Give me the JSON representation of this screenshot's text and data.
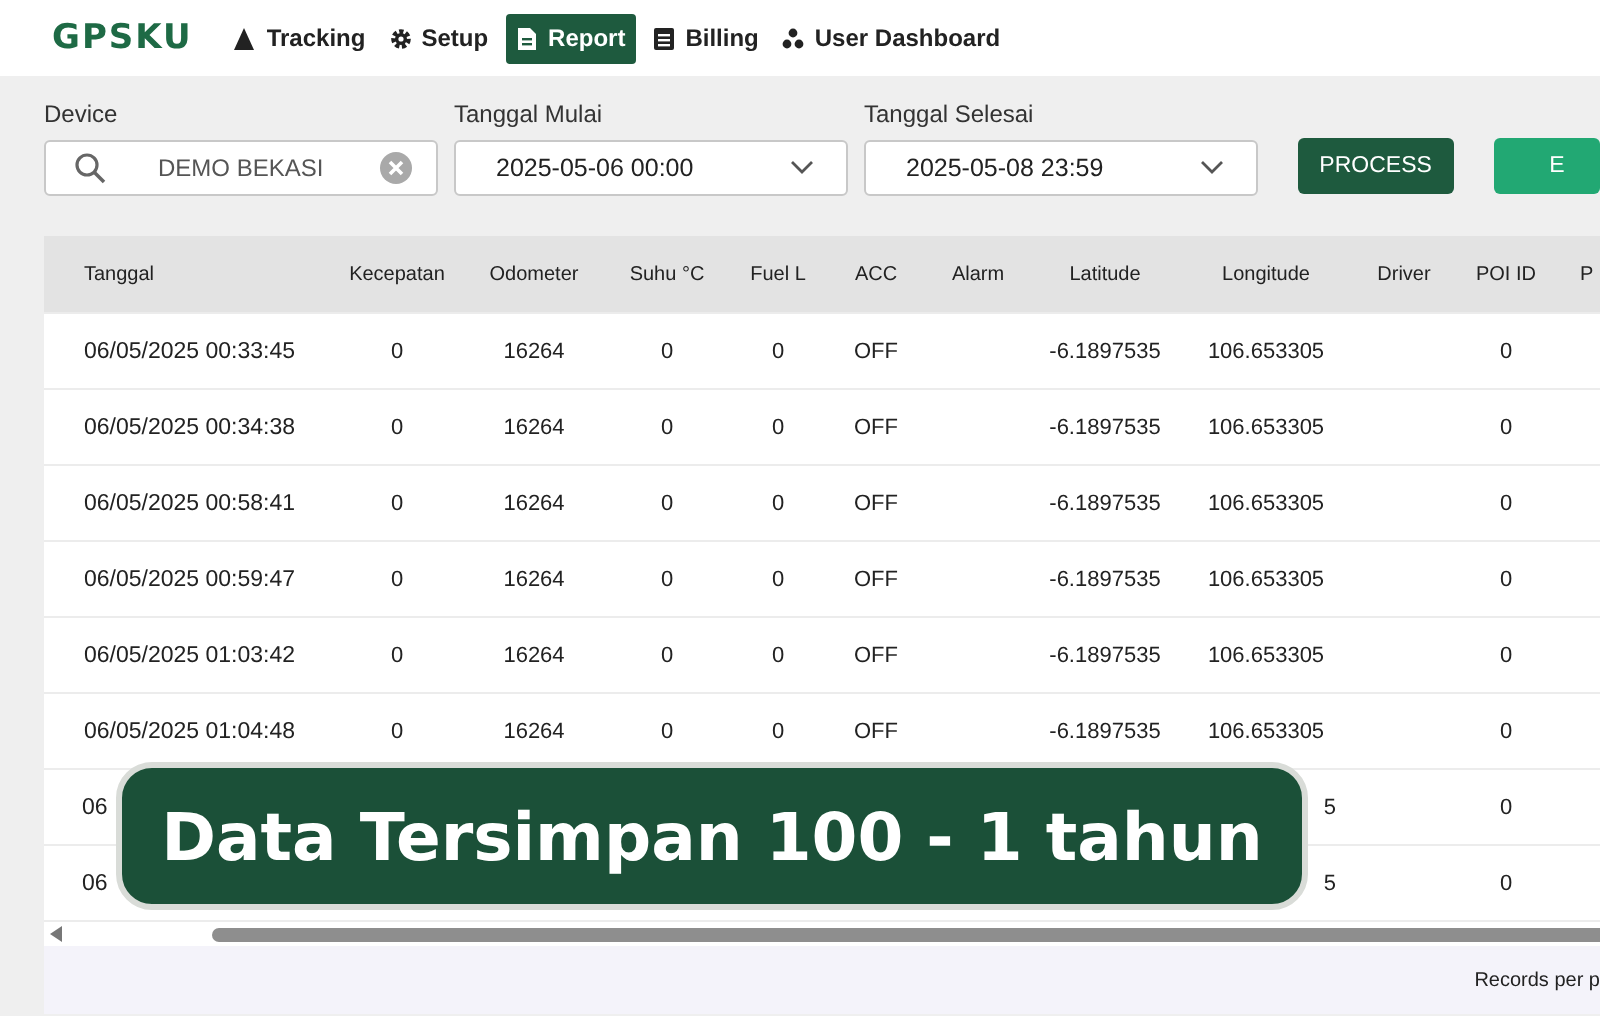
{
  "logo": "GPSKU",
  "nav": [
    {
      "label": "Tracking",
      "selected": false
    },
    {
      "label": "Setup",
      "selected": false
    },
    {
      "label": "Report",
      "selected": true
    },
    {
      "label": "Billing",
      "selected": false
    },
    {
      "label": "User Dashboard",
      "selected": false
    }
  ],
  "filters": {
    "device": {
      "label": "Device",
      "value": "DEMO BEKASI"
    },
    "start": {
      "label": "Tanggal Mulai",
      "value": "2025-05-06 00:00"
    },
    "end": {
      "label": "Tanggal Selesai",
      "value": "2025-05-08 23:59"
    },
    "buttons": [
      {
        "label": "PROCESS",
        "kind": "primary"
      },
      {
        "label": "E",
        "kind": "secondary"
      }
    ]
  },
  "table": {
    "columns": [
      "Tanggal",
      "Kecepatan",
      "Odometer",
      "Suhu °C",
      "Fuel L",
      "ACC",
      "Alarm",
      "Latitude",
      "Longitude",
      "Driver",
      "POI ID",
      "P"
    ],
    "rows": [
      {
        "cells": [
          "06/05/2025 00:33:45",
          "0",
          "16264",
          "0",
          "0",
          "OFF",
          "",
          "-6.1897535",
          "106.653305",
          "",
          "0",
          ""
        ]
      },
      {
        "cells": [
          "06/05/2025 00:34:38",
          "0",
          "16264",
          "0",
          "0",
          "OFF",
          "",
          "-6.1897535",
          "106.653305",
          "",
          "0",
          ""
        ]
      },
      {
        "cells": [
          "06/05/2025 00:58:41",
          "0",
          "16264",
          "0",
          "0",
          "OFF",
          "",
          "-6.1897535",
          "106.653305",
          "",
          "0",
          ""
        ]
      },
      {
        "cells": [
          "06/05/2025 00:59:47",
          "0",
          "16264",
          "0",
          "0",
          "OFF",
          "",
          "-6.1897535",
          "106.653305",
          "",
          "0",
          ""
        ]
      },
      {
        "cells": [
          "06/05/2025 01:03:42",
          "0",
          "16264",
          "0",
          "0",
          "OFF",
          "",
          "-6.1897535",
          "106.653305",
          "",
          "0",
          ""
        ]
      },
      {
        "cells": [
          "06/05/2025 01:04:48",
          "0",
          "16264",
          "0",
          "0",
          "OFF",
          "",
          "-6.1897535",
          "106.653305",
          "",
          "0",
          ""
        ]
      },
      {
        "partial": true,
        "cells": [
          "06",
          "",
          "",
          "",
          "",
          "",
          "",
          "",
          "5",
          "",
          "0",
          ""
        ]
      },
      {
        "partial": true,
        "cells": [
          "06",
          "",
          "",
          "",
          "",
          "",
          "",
          "",
          "5",
          "",
          "0",
          ""
        ]
      }
    ]
  },
  "footer": {
    "records_label": "Records per p"
  },
  "banner": {
    "text": "Data Tersimpan 100 - 1 tahun"
  }
}
